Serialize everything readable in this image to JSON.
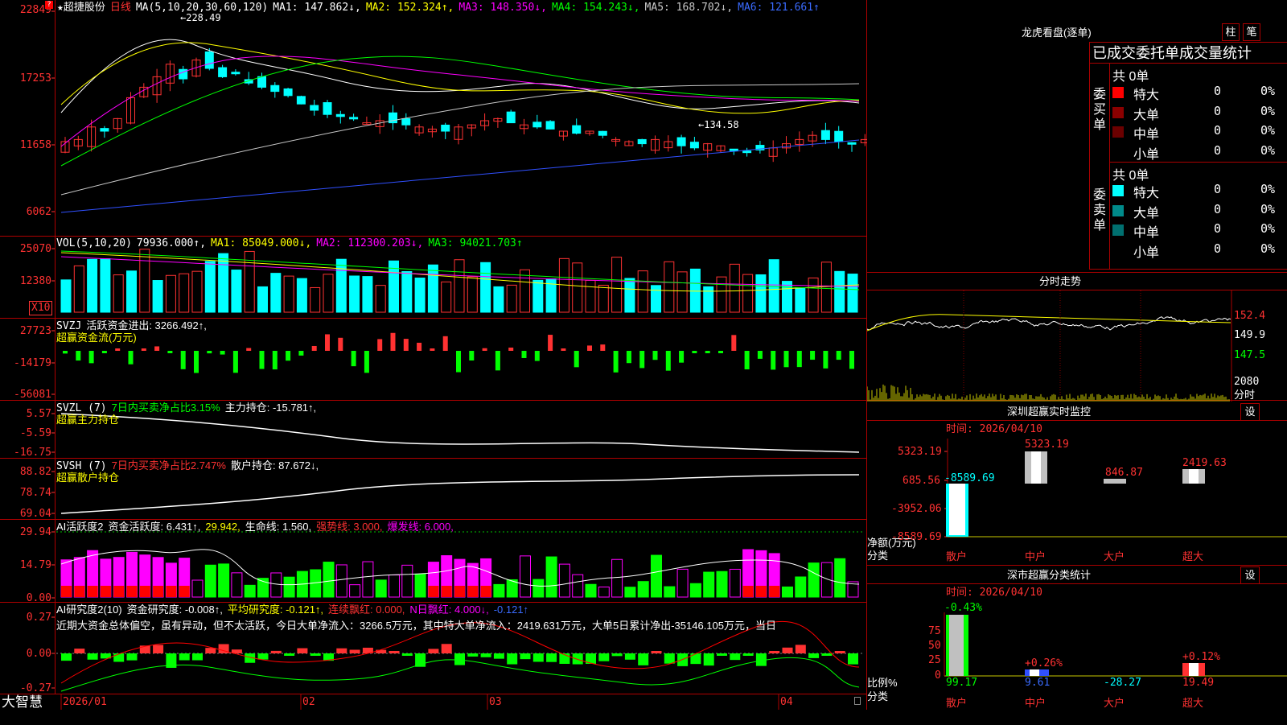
{
  "kline": {
    "star": "★",
    "stock_name": "超捷股份",
    "period": "日线",
    "ma_label": "MA(5,10,20,30,60,120)",
    "ma_values": [
      {
        "label": "MA1: 147.862↓,",
        "color": "#ffffff"
      },
      {
        "label": "MA2: 152.324↑,",
        "color": "#ffff00"
      },
      {
        "label": "MA3: 148.350↓,",
        "color": "#ff00ff"
      },
      {
        "label": "MA4: 154.243↓,",
        "color": "#00ff00"
      },
      {
        "label": "MA5: 168.702↓,",
        "color": "#c8c8c8"
      },
      {
        "label": "MA6: 121.661↑",
        "color": "#3a6bff"
      }
    ],
    "y_labels": [
      "22849",
      "17253",
      "11658",
      "6062"
    ],
    "high_note": "←228.49",
    "low_note": "←134.58",
    "q_icon": "?"
  },
  "vol": {
    "header": "VOL(5,10,20)",
    "value": "79936.000↑,",
    "ma1": "MA1: 85049.000↓,",
    "ma2": "MA2: 112300.203↓,",
    "ma3": "MA3: 94021.703↑",
    "y_labels": [
      "25070",
      "12380"
    ],
    "unit": "X10"
  },
  "svzj": {
    "header": "SVZJ",
    "label": "活跃资金进出: 3266.492↑,",
    "sub": "超赢资金流(万元)",
    "y_labels": [
      "27723",
      "-14179",
      "-56081"
    ]
  },
  "svzl": {
    "header": "SVZL (7)",
    "label1": "7日内买卖净占比3.15%",
    "label2": "主力持仓: -15.781↑,",
    "sub": "超赢主力持仓",
    "y_labels": [
      "5.57",
      "-5.59",
      "-16.75"
    ]
  },
  "svsh": {
    "header": "SVSH (7)",
    "label1": "7日内买卖净占比2.747%",
    "label2": "散户持仓: 87.672↓,",
    "sub": "超赢散户持仓",
    "y_labels": [
      "88.82",
      "78.74",
      "69.04"
    ]
  },
  "ai1": {
    "header": "AI活跃度2",
    "l1": "资金活跃度: 6.431↑,",
    "l2": "29.942,",
    "l3": "生命线: 1.560,",
    "l4": "强势线: 3.000,",
    "l5": "爆发线: 6.000,",
    "y_labels": [
      "29.94",
      "14.79",
      "0.00"
    ]
  },
  "ai2": {
    "header": "AI研究度2(10)",
    "l1": "资金研究度: -0.008↑,",
    "l2": "平均研究度: -0.121↑,",
    "l3": "连续飘红: 0.000,",
    "l4": "N日飘红: 4.000↓,",
    "l5": "-0.121↑",
    "comment": "近期大资金总体偏空，虽有异动，但不太活跃，今日大单净流入：3266.5万元，其中特大单净流入：2419.631万元，大单5日累计净出-35146.105万元，当日",
    "y_labels": [
      "0.27",
      "0.00",
      "-0.27"
    ]
  },
  "bottom": {
    "app_name": "大智慧",
    "dates": [
      "2026/01",
      "02",
      "03",
      "04"
    ]
  },
  "lhb": {
    "title": "龙虎看盘(逐单)",
    "btn1": "柱",
    "btn2": "笔",
    "subtitle": "已成交委托单成交量统计",
    "buy_side": "委买单",
    "sell_side": "委卖单",
    "buy_total": "共 0单",
    "sell_total": "共 0单",
    "buy_rows": [
      {
        "label": "特大",
        "count": "0",
        "pct": "0%",
        "color": "#ff0000"
      },
      {
        "label": "大单",
        "count": "0",
        "pct": "0%",
        "color": "#8b0000"
      },
      {
        "label": "中单",
        "count": "0",
        "pct": "0%",
        "color": "#6b0000"
      },
      {
        "label": "小单",
        "count": "0",
        "pct": "0%",
        "color": "#000000"
      }
    ],
    "sell_rows": [
      {
        "label": "特大",
        "count": "0",
        "pct": "0%",
        "color": "#00ffff"
      },
      {
        "label": "大单",
        "count": "0",
        "pct": "0%",
        "color": "#008b8b"
      },
      {
        "label": "中单",
        "count": "0",
        "pct": "0%",
        "color": "#007070"
      },
      {
        "label": "小单",
        "count": "0",
        "pct": "0%",
        "color": "#000000"
      }
    ]
  },
  "fenshi": {
    "title": "分时走势",
    "prices": [
      "152.4",
      "149.9",
      "147.5"
    ],
    "vol": "2080",
    "vol_unit": "分时"
  },
  "monitor": {
    "title": "深圳超赢实时监控",
    "btn": "设",
    "time": "时间: 2026/04/10",
    "y_labels": [
      "5323.19",
      "685.56",
      "-3952.06",
      "-8589.69"
    ],
    "axis_label1": "净额(万元)",
    "axis_label2": "分类",
    "categories": [
      "散户",
      "中户",
      "大户",
      "超大"
    ],
    "values": [
      -8589.69,
      5323.19,
      846.87,
      2419.63
    ],
    "value_labels": [
      "-8589.69",
      "5323.19",
      "846.87",
      "2419.63"
    ]
  },
  "classify": {
    "title": "深市超赢分类统计",
    "btn": "设",
    "time": "时间: 2026/04/10",
    "y_labels": [
      "75",
      "50",
      "25",
      "0"
    ],
    "axis_label1": "比例%",
    "axis_label2": "分类",
    "categories": [
      "散户",
      "中户",
      "大户",
      "超大"
    ],
    "bottom_values": [
      "99.17",
      "9.61",
      "-28.27",
      "19.49"
    ],
    "top_labels": [
      "-0.43%",
      "+0.26%",
      "",
      "+0.12%"
    ]
  }
}
